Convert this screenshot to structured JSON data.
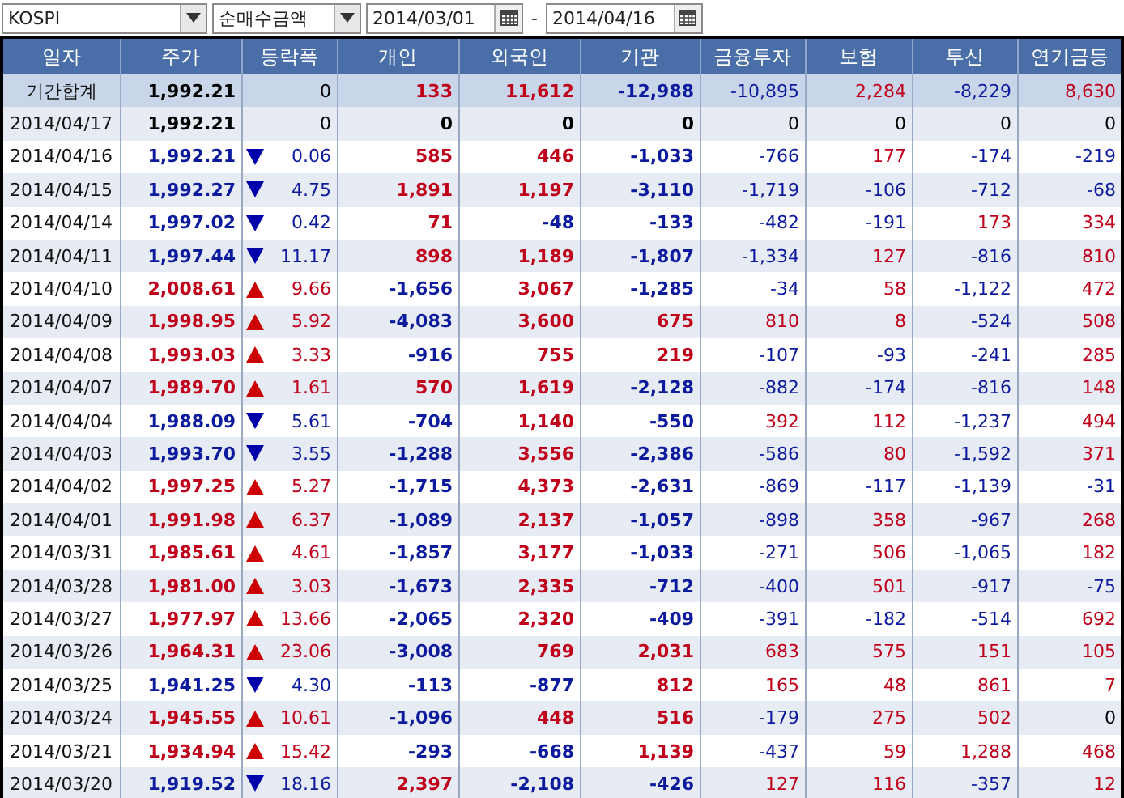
{
  "toolbar": {
    "market": "KOSPI",
    "measure": "순매수금액",
    "start_date": "2014/03/01",
    "separator": "-",
    "end_date": "2014/04/16"
  },
  "table": {
    "columns": [
      "일자",
      "주가",
      "등락폭",
      "개인",
      "외국인",
      "기관",
      "금융투자",
      "보험",
      "투신",
      "연기금등"
    ],
    "summary": {
      "label": "기간합계",
      "price": "1,992.21",
      "change": "0",
      "values": [
        "133",
        "11,612",
        "-12,988",
        "-10,895",
        "2,284",
        "-8,229",
        "8,630"
      ]
    },
    "rows": [
      {
        "date": "2014/04/17",
        "price": "1,992.21",
        "kind": "flat",
        "change": "0",
        "values": [
          "0",
          "0",
          "0",
          "0",
          "0",
          "0",
          "0"
        ]
      },
      {
        "date": "2014/04/16",
        "price": "1,992.21",
        "kind": "down",
        "change": "0.06",
        "values": [
          "585",
          "446",
          "-1,033",
          "-766",
          "177",
          "-174",
          "-219"
        ]
      },
      {
        "date": "2014/04/15",
        "price": "1,992.27",
        "kind": "down",
        "change": "4.75",
        "values": [
          "1,891",
          "1,197",
          "-3,110",
          "-1,719",
          "-106",
          "-712",
          "-68"
        ]
      },
      {
        "date": "2014/04/14",
        "price": "1,997.02",
        "kind": "down",
        "change": "0.42",
        "values": [
          "71",
          "-48",
          "-133",
          "-482",
          "-191",
          "173",
          "334"
        ]
      },
      {
        "date": "2014/04/11",
        "price": "1,997.44",
        "kind": "down",
        "change": "11.17",
        "values": [
          "898",
          "1,189",
          "-1,807",
          "-1,334",
          "127",
          "-816",
          "810"
        ]
      },
      {
        "date": "2014/04/10",
        "price": "2,008.61",
        "kind": "up",
        "change": "9.66",
        "values": [
          "-1,656",
          "3,067",
          "-1,285",
          "-34",
          "58",
          "-1,122",
          "472"
        ]
      },
      {
        "date": "2014/04/09",
        "price": "1,998.95",
        "kind": "up",
        "change": "5.92",
        "values": [
          "-4,083",
          "3,600",
          "675",
          "810",
          "8",
          "-524",
          "508"
        ]
      },
      {
        "date": "2014/04/08",
        "price": "1,993.03",
        "kind": "up",
        "change": "3.33",
        "values": [
          "-916",
          "755",
          "219",
          "-107",
          "-93",
          "-241",
          "285"
        ]
      },
      {
        "date": "2014/04/07",
        "price": "1,989.70",
        "kind": "up",
        "change": "1.61",
        "values": [
          "570",
          "1,619",
          "-2,128",
          "-882",
          "-174",
          "-816",
          "148"
        ]
      },
      {
        "date": "2014/04/04",
        "price": "1,988.09",
        "kind": "down",
        "change": "5.61",
        "values": [
          "-704",
          "1,140",
          "-550",
          "392",
          "112",
          "-1,237",
          "494"
        ]
      },
      {
        "date": "2014/04/03",
        "price": "1,993.70",
        "kind": "down",
        "change": "3.55",
        "values": [
          "-1,288",
          "3,556",
          "-2,386",
          "-586",
          "80",
          "-1,592",
          "371"
        ]
      },
      {
        "date": "2014/04/02",
        "price": "1,997.25",
        "kind": "up",
        "change": "5.27",
        "values": [
          "-1,715",
          "4,373",
          "-2,631",
          "-869",
          "-117",
          "-1,139",
          "-31"
        ]
      },
      {
        "date": "2014/04/01",
        "price": "1,991.98",
        "kind": "up",
        "change": "6.37",
        "values": [
          "-1,089",
          "2,137",
          "-1,057",
          "-898",
          "358",
          "-967",
          "268"
        ]
      },
      {
        "date": "2014/03/31",
        "price": "1,985.61",
        "kind": "up",
        "change": "4.61",
        "values": [
          "-1,857",
          "3,177",
          "-1,033",
          "-271",
          "506",
          "-1,065",
          "182"
        ]
      },
      {
        "date": "2014/03/28",
        "price": "1,981.00",
        "kind": "up",
        "change": "3.03",
        "values": [
          "-1,673",
          "2,335",
          "-712",
          "-400",
          "501",
          "-917",
          "-75"
        ]
      },
      {
        "date": "2014/03/27",
        "price": "1,977.97",
        "kind": "up",
        "change": "13.66",
        "values": [
          "-2,065",
          "2,320",
          "-409",
          "-391",
          "-182",
          "-514",
          "692"
        ]
      },
      {
        "date": "2014/03/26",
        "price": "1,964.31",
        "kind": "up",
        "change": "23.06",
        "values": [
          "-3,008",
          "769",
          "2,031",
          "683",
          "575",
          "151",
          "105"
        ]
      },
      {
        "date": "2014/03/25",
        "price": "1,941.25",
        "kind": "down",
        "change": "4.30",
        "values": [
          "-113",
          "-877",
          "812",
          "165",
          "48",
          "861",
          "7"
        ]
      },
      {
        "date": "2014/03/24",
        "price": "1,945.55",
        "kind": "up",
        "change": "10.61",
        "values": [
          "-1,096",
          "448",
          "516",
          "-179",
          "275",
          "502",
          "0"
        ]
      },
      {
        "date": "2014/03/21",
        "price": "1,934.94",
        "kind": "up",
        "change": "15.42",
        "values": [
          "-293",
          "-668",
          "1,139",
          "-437",
          "59",
          "1,288",
          "468"
        ]
      },
      {
        "date": "2014/03/20",
        "price": "1,919.52",
        "kind": "down",
        "change": "18.16",
        "values": [
          "2,397",
          "-2,108",
          "-426",
          "127",
          "116",
          "-357",
          "12"
        ]
      }
    ]
  }
}
